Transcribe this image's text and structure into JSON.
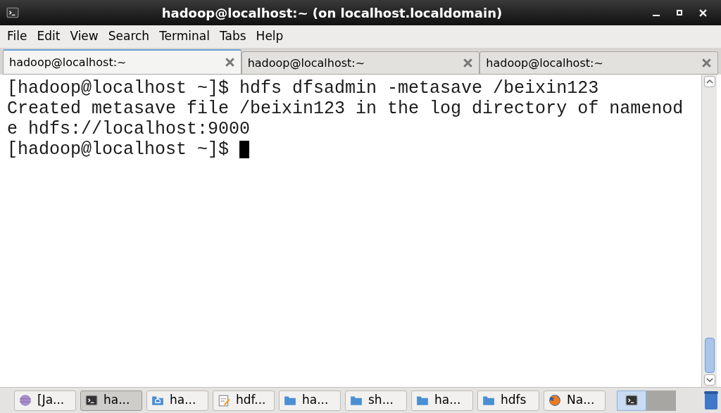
{
  "window": {
    "title": "hadoop@localhost:~ (on localhost.localdomain)"
  },
  "menu": [
    "File",
    "Edit",
    "View",
    "Search",
    "Terminal",
    "Tabs",
    "Help"
  ],
  "tabs": [
    {
      "label": "hadoop@localhost:~",
      "selected": true
    },
    {
      "label": "hadoop@localhost:~",
      "selected": false
    },
    {
      "label": "hadoop@localhost:~",
      "selected": false
    }
  ],
  "terminal": {
    "lines": [
      "[hadoop@localhost ~]$ hdfs dfsadmin -metasave /beixin123",
      "Created metasave file /beixin123 in the log directory of namenod",
      "e hdfs://localhost:9000",
      "[hadoop@localhost ~]$ "
    ],
    "cursor": true
  },
  "taskbar": {
    "buttons": [
      {
        "label": "[Ja...",
        "kind": "sphere",
        "selected": false
      },
      {
        "label": "ha...",
        "kind": "terminal",
        "selected": true
      },
      {
        "label": "ha...",
        "kind": "home",
        "selected": false
      },
      {
        "label": "hdf...",
        "kind": "editor",
        "selected": false
      },
      {
        "label": "ha...",
        "kind": "folder",
        "selected": false
      },
      {
        "label": "sh...",
        "kind": "folder",
        "selected": false
      },
      {
        "label": "ha...",
        "kind": "folder",
        "selected": false
      },
      {
        "label": "hdfs",
        "kind": "folder",
        "selected": false
      },
      {
        "label": "Na...",
        "kind": "browser",
        "selected": false
      }
    ],
    "workspaces": [
      {
        "selected": true
      },
      {
        "selected": false
      }
    ]
  }
}
